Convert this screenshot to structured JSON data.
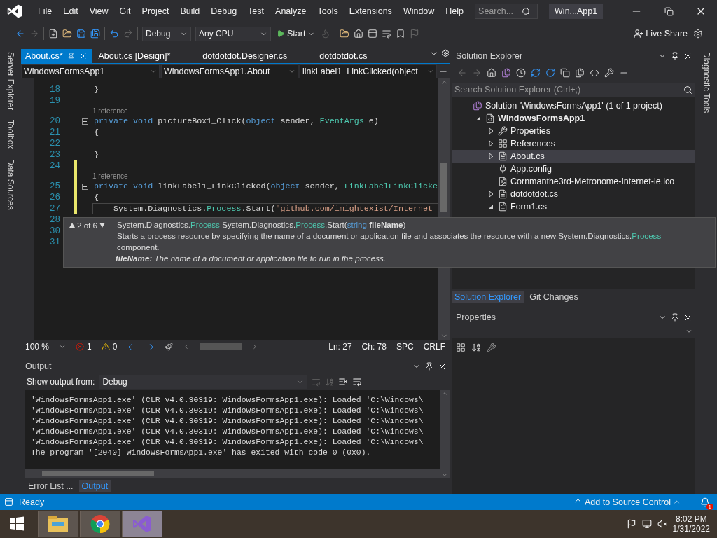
{
  "title_bar": {
    "menu": [
      "File",
      "Edit",
      "View",
      "Git",
      "Project",
      "Build",
      "Debug",
      "Test",
      "Analyze",
      "Tools",
      "Extensions",
      "Window",
      "Help"
    ],
    "search": {
      "placeholder": "Search..."
    },
    "title": "Win...App1"
  },
  "toolbar": {
    "configuration": "Debug",
    "platform": "Any CPU",
    "start": "Start",
    "live_share": "Live Share"
  },
  "left_strip": [
    "Server Explorer",
    "Toolbox",
    "Data Sources"
  ],
  "editor": {
    "tabs": [
      {
        "label": "About.cs*",
        "selected": true
      },
      {
        "label": "About.cs [Design]*",
        "selected": false
      },
      {
        "label": "dotdotdot.Designer.cs",
        "selected": false
      },
      {
        "label": "dotdotdot.cs",
        "selected": false
      }
    ],
    "nav": [
      "WindowsFormsApp1",
      "WindowsFormsApp1.About",
      "linkLabel1_LinkClicked(object"
    ],
    "lines": [
      {
        "kind": "code",
        "number": "18",
        "changed": false,
        "foldable": false,
        "current": false,
        "tokens": [
          {
            "kind": "plain",
            "text": "}"
          }
        ]
      },
      {
        "kind": "code",
        "number": "19",
        "changed": false,
        "foldable": false,
        "current": false
      },
      {
        "kind": "lens",
        "text": "1 reference",
        "changed": false
      },
      {
        "kind": "code",
        "number": "20",
        "changed": false,
        "foldable": true,
        "current": false,
        "tokens": [
          {
            "kind": "kw",
            "text": "private void"
          },
          {
            "kind": "plain",
            "text": " pictureBox1_Click("
          },
          {
            "kind": "kw",
            "text": "object"
          },
          {
            "kind": "plain",
            "text": " sender, "
          },
          {
            "kind": "type",
            "text": "EventArgs"
          },
          {
            "kind": "plain",
            "text": " e)"
          }
        ]
      },
      {
        "kind": "code",
        "number": "21",
        "changed": false,
        "foldable": false,
        "current": false,
        "tokens": [
          {
            "kind": "plain",
            "text": "{"
          }
        ]
      },
      {
        "kind": "code",
        "number": "22",
        "changed": false,
        "foldable": false,
        "current": false
      },
      {
        "kind": "code",
        "number": "23",
        "changed": false,
        "foldable": false,
        "current": false,
        "tokens": [
          {
            "kind": "plain",
            "text": "}"
          }
        ]
      },
      {
        "kind": "code",
        "number": "24",
        "changed": true,
        "foldable": false,
        "current": false
      },
      {
        "kind": "lens",
        "text": "1 reference",
        "changed": true
      },
      {
        "kind": "code",
        "number": "25",
        "changed": true,
        "foldable": true,
        "current": false,
        "tokens": [
          {
            "kind": "kw",
            "text": "private void"
          },
          {
            "kind": "plain",
            "text": " linkLabel1_LinkClicked("
          },
          {
            "kind": "kw",
            "text": "object"
          },
          {
            "kind": "plain",
            "text": " sender, "
          },
          {
            "kind": "type",
            "text": "LinkLabelLinkClicke"
          }
        ]
      },
      {
        "kind": "code",
        "number": "26",
        "changed": true,
        "foldable": false,
        "current": false,
        "tokens": [
          {
            "kind": "plain",
            "text": "{"
          }
        ]
      },
      {
        "kind": "code",
        "number": "27",
        "changed": true,
        "foldable": false,
        "current": true,
        "tokens": [
          {
            "kind": "plain",
            "text": "    System.Diagnostics."
          },
          {
            "kind": "type",
            "text": "Process"
          },
          {
            "kind": "plain",
            "text": ".Start("
          },
          {
            "kind": "str",
            "text": "\"github.com/imightexist/Internet"
          }
        ]
      },
      {
        "kind": "code",
        "number": "28"
      },
      {
        "kind": "code",
        "number": "30"
      },
      {
        "kind": "code",
        "number": "31"
      }
    ],
    "tooltip": {
      "counter": "2 of 6",
      "signature": [
        {
          "kind": "plain",
          "text": "System.Diagnostics."
        },
        {
          "kind": "type",
          "text": "Process"
        },
        {
          "kind": "plain",
          "text": " System.Diagnostics."
        },
        {
          "kind": "type",
          "text": "Process"
        },
        {
          "kind": "plain",
          "text": ".Start("
        },
        {
          "kind": "kw",
          "text": "string"
        },
        {
          "kind": "param",
          "text": " fileName"
        },
        {
          "kind": "plain",
          "text": ")"
        }
      ],
      "description": [
        {
          "kind": "plain",
          "text": "Starts a process resource by specifying the name of a document or application file and associates the resource with a new System.Diagnostics."
        },
        {
          "kind": "type",
          "text": "Process"
        },
        {
          "kind": "plain",
          "text": " component."
        }
      ],
      "parameter": {
        "name": "fileName:",
        "description": "The name of a document or application file to run in the process."
      }
    },
    "status": {
      "zoom": "100 %",
      "errors": "1",
      "warnings": "0",
      "line": "Ln: 27",
      "column": "Ch: 78",
      "whitespace": "SPC",
      "line_ending": "CRLF"
    }
  },
  "output": {
    "title": "Output",
    "source_label": "Show output from:",
    "source": "Debug",
    "lines": [
      "'WindowsFormsApp1.exe' (CLR v4.0.30319: WindowsFormsApp1.exe): Loaded 'C:\\Windows\\",
      "'WindowsFormsApp1.exe' (CLR v4.0.30319: WindowsFormsApp1.exe): Loaded 'C:\\Windows\\",
      "'WindowsFormsApp1.exe' (CLR v4.0.30319: WindowsFormsApp1.exe): Loaded 'C:\\Windows\\",
      "'WindowsFormsApp1.exe' (CLR v4.0.30319: WindowsFormsApp1.exe): Loaded 'C:\\Windows\\",
      "'WindowsFormsApp1.exe' (CLR v4.0.30319: WindowsFormsApp1.exe): Loaded 'C:\\Windows\\",
      "The program '[2040] WindowsFormsApp1.exe' has exited with code 0 (0x0)."
    ],
    "tabs": [
      {
        "label": "Error List ...",
        "selected": false
      },
      {
        "label": "Output",
        "selected": true
      }
    ]
  },
  "solution_explorer": {
    "title": "Solution Explorer",
    "search": {
      "placeholder": "Search Solution Explorer (Ctrl+;)"
    },
    "tree": [
      {
        "label": "Solution 'WindowsFormsApp1' (1 of 1 project)",
        "kind": "solution",
        "selected": false,
        "children": [
          {
            "label": "WindowsFormsApp1",
            "kind": "project",
            "expanded": true,
            "selected": false,
            "children": [
              {
                "label": "Properties",
                "kind": "properties",
                "expanded": false,
                "selected": false
              },
              {
                "label": "References",
                "kind": "references",
                "expanded": false,
                "selected": false
              },
              {
                "label": "About.cs",
                "kind": "form",
                "expanded": false,
                "selected": true
              },
              {
                "label": "App.config",
                "kind": "config",
                "selected": false
              },
              {
                "label": "Cornmanthe3rd-Metronome-Internet-ie.ico",
                "kind": "image",
                "selected": false
              },
              {
                "label": "dotdotdot.cs",
                "kind": "form",
                "expanded": false,
                "selected": false
              },
              {
                "label": "Form1.cs",
                "kind": "form",
                "expanded": true,
                "selected": false
              }
            ]
          }
        ]
      }
    ],
    "tabs": [
      {
        "label": "Solution Explorer",
        "selected": true
      },
      {
        "label": "Git Changes",
        "selected": false
      }
    ]
  },
  "properties": {
    "title": "Properties"
  },
  "right_strip": "Diagnostic Tools",
  "status_bar": {
    "state": "Ready",
    "source_control": "Add to Source Control",
    "notifications": "1"
  },
  "taskbar": {
    "apps": [
      {
        "kind": "files",
        "selected": false
      },
      {
        "kind": "browser",
        "selected": false
      },
      {
        "kind": "ide",
        "selected": true
      }
    ],
    "time": "8:02 PM",
    "date": "1/31/2022"
  }
}
